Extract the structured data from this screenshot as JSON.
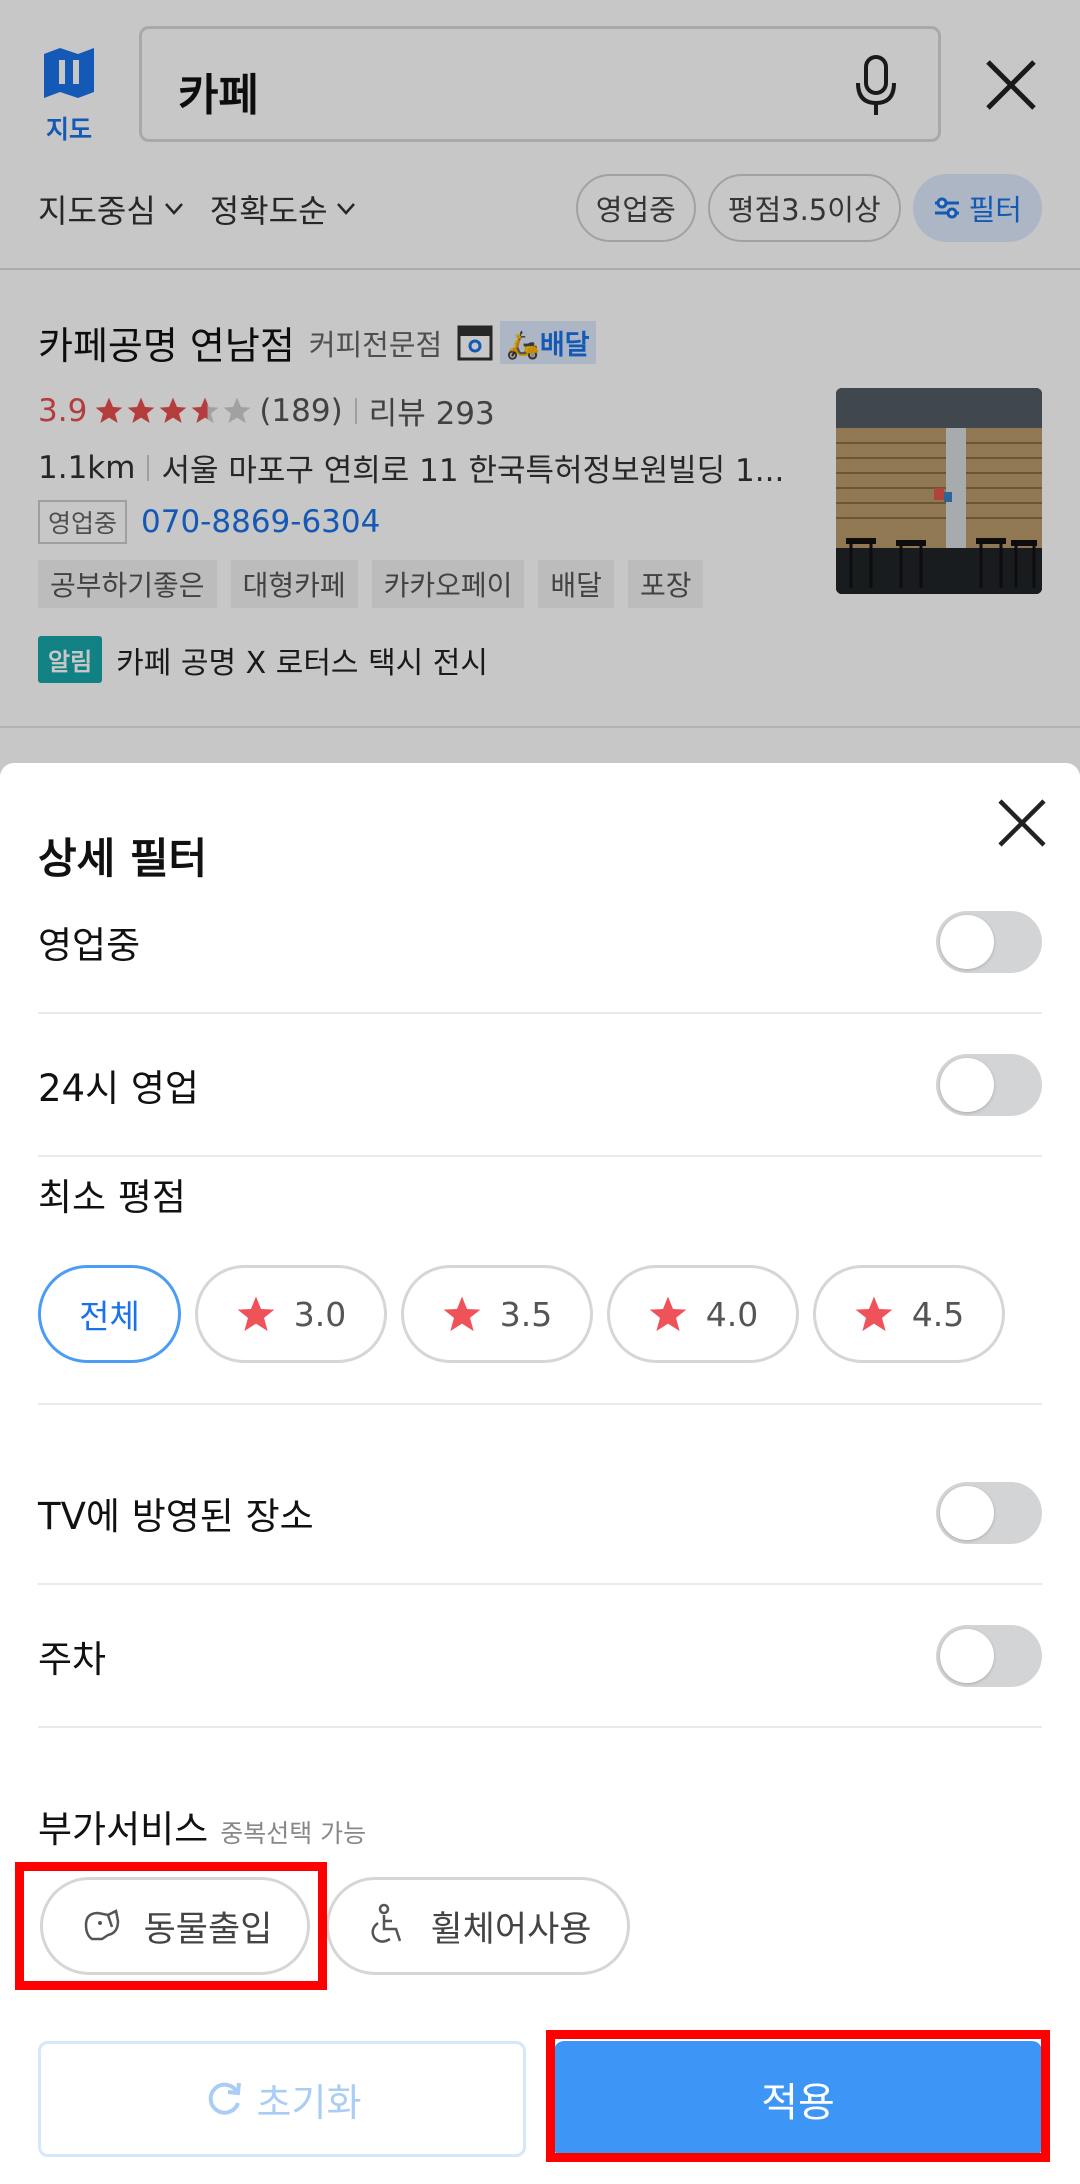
{
  "header": {
    "logo_label": "지도",
    "search_value": "카페",
    "sort_options": [
      "지도중심",
      "정확도순"
    ],
    "chips": [
      "영업중",
      "평점3.5이상"
    ],
    "filter_label": "필터"
  },
  "result": {
    "name": "카페공명 연남점",
    "category": "커피전문점",
    "delivery_label": "배달",
    "score": "3.9",
    "rating_value": 3.9,
    "review_count": "(189)",
    "review_label": "리뷰 293",
    "distance": "1.1km",
    "address": "서울 마포구 연희로 11 한국특허정보원빌딩 1...",
    "status_tag": "영업중",
    "phone": "070-8869-6304",
    "tags": [
      "공부하기좋은",
      "대형카페",
      "카카오페이",
      "배달",
      "포장"
    ],
    "notice_badge": "알림",
    "notice_text": "카페 공명 X 로터스 택시 전시"
  },
  "filter_sheet": {
    "title": "상세 필터",
    "open_now_label": "영업중",
    "open_24h_label": "24시 영업",
    "min_rating_label": "최소 평점",
    "rating_options": [
      "전체",
      "3.0",
      "3.5",
      "4.0",
      "4.5"
    ],
    "selected_rating": "전체",
    "tv_label": "TV에 방영된 장소",
    "parking_label": "주차",
    "extra_services_label": "부가서비스",
    "extra_services_sub": "중복선택 가능",
    "services": [
      "동물출입",
      "휠체어사용"
    ],
    "reset_label": "초기화",
    "apply_label": "적용"
  },
  "colors": {
    "accent": "#3d96f6",
    "link": "#1a73e8",
    "star": "#f0525a",
    "highlight": "#ff0000"
  }
}
